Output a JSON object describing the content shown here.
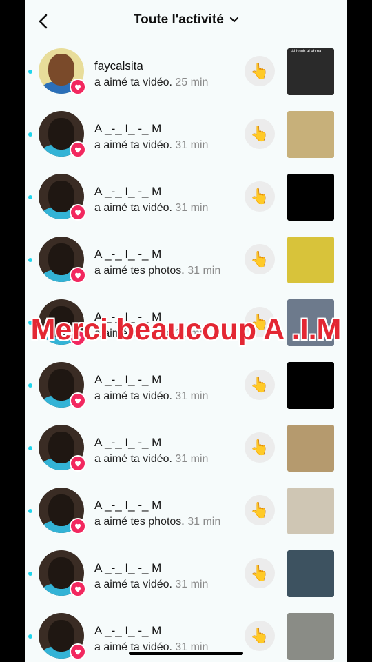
{
  "header": {
    "title": "Toute l'activité",
    "back_icon": "back-arrow-icon",
    "dropdown_icon": "chevron-down-icon"
  },
  "overlay_text": "Merci beaucoup A .I.M",
  "items": [
    {
      "name": "faycalsita",
      "action": "a aimé ta vidéo.",
      "time": "25 min",
      "thumb_label": "Al houb al ahma",
      "thumb_color": "#2a2a2a",
      "avatar": "yellow"
    },
    {
      "name": "A _-_ I_ -_ M",
      "action": "a aimé ta vidéo.",
      "time": "31 min",
      "thumb_label": "",
      "thumb_color": "#c7b07a",
      "avatar": "dark"
    },
    {
      "name": "A _-_ I_ -_ M",
      "action": "a aimé ta vidéo.",
      "time": "31 min",
      "thumb_label": "",
      "thumb_color": "#000000",
      "avatar": "dark"
    },
    {
      "name": "A _-_ I_ -_ M",
      "action": "a aimé tes photos.",
      "time": "31 min",
      "thumb_label": "",
      "thumb_color": "#d8c33a",
      "avatar": "dark"
    },
    {
      "name": "A _-_ I_ -_ M",
      "action": "a aimé ta vidéo.",
      "time": "31 min",
      "thumb_label": "",
      "thumb_color": "#6d7a8c",
      "avatar": "dark"
    },
    {
      "name": "A _-_ I_ -_ M",
      "action": "a aimé ta vidéo.",
      "time": "31 min",
      "thumb_label": "",
      "thumb_color": "#000000",
      "avatar": "dark"
    },
    {
      "name": "A _-_ I_ -_ M",
      "action": "a aimé ta vidéo.",
      "time": "31 min",
      "thumb_label": "",
      "thumb_color": "#b59a6e",
      "avatar": "dark"
    },
    {
      "name": "A _-_ I_ -_ M",
      "action": "a aimé tes photos.",
      "time": "31 min",
      "thumb_label": "",
      "thumb_color": "#cfc6b4",
      "avatar": "dark"
    },
    {
      "name": "A _-_ I_ -_ M",
      "action": "a aimé ta vidéo.",
      "time": "31 min",
      "thumb_label": "",
      "thumb_color": "#3d5260",
      "avatar": "dark"
    },
    {
      "name": "A _-_ I_ -_ M",
      "action": "a aimé ta vidéo.",
      "time": "31 min",
      "thumb_label": "",
      "thumb_color": "#8a8c86",
      "avatar": "dark"
    }
  ],
  "colors": {
    "accent_heart": "#f2285f",
    "unread_dot": "#20d5ec",
    "overlay_text": "#e32733"
  }
}
